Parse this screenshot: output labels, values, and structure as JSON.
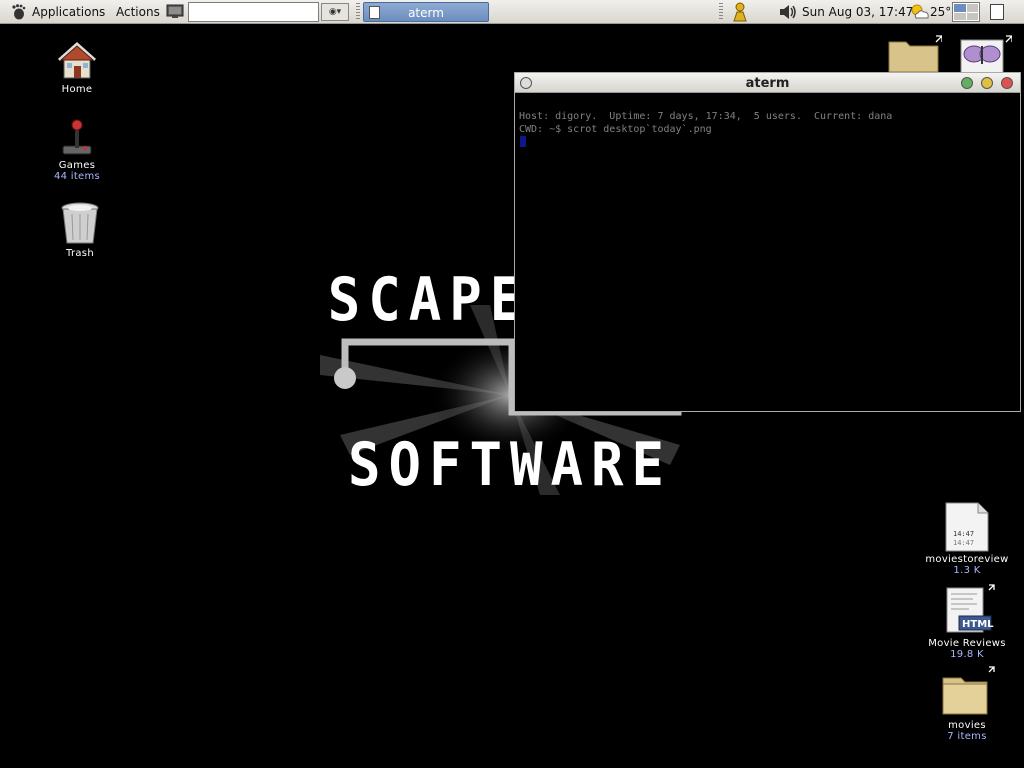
{
  "panel": {
    "menu_applications": "Applications",
    "menu_actions": "Actions",
    "command_value": "",
    "task_button_label": "aterm",
    "clock": "Sun Aug 03, 17:47",
    "temperature": "25°",
    "icons": {
      "foot": "gnome-foot-icon",
      "monitor": "run-command-icon",
      "person": "user-icon",
      "volume": "volume-icon",
      "weather": "partly-cloudy-icon",
      "show_desktop": "show-desktop-icon"
    }
  },
  "desktop": {
    "left_icons": [
      {
        "name": "Home",
        "sub": "",
        "icon": "home-icon"
      },
      {
        "name": "Games",
        "sub": "44 items",
        "icon": "joystick-icon"
      },
      {
        "name": "Trash",
        "sub": "",
        "icon": "trash-icon"
      }
    ],
    "right_icons": [
      {
        "name": "moviestoreview",
        "sub": "1.3 K",
        "icon": "text-file-icon",
        "preview": "14:47\n14:47"
      },
      {
        "name": "Movie Reviews",
        "sub": "19.8 K",
        "icon": "html-file-icon",
        "badge": "HTML"
      },
      {
        "name": "movies",
        "sub": "7 items",
        "icon": "folder-icon"
      }
    ],
    "top_right_icons": [
      {
        "icon": "folder-link-icon"
      },
      {
        "icon": "butterfly-image-icon"
      }
    ]
  },
  "wallpaper": {
    "line1": "SCAPEGOAT",
    "line2": "SOFTWARE"
  },
  "terminal": {
    "title": "aterm",
    "line1": "Host: digory.  Uptime: 7 days, 17:34,  5 users.  Current: dana",
    "line2": "CWD: ~$ scrot desktop`today`.png"
  },
  "colors": {
    "panel_bg": "#e4e2dc",
    "task_button": "#7a9ac8",
    "desktop_bg": "#000000",
    "icon_subtext": "#a9b7ff",
    "cursor": "#1a2bff",
    "close_button": "#e05050",
    "minimize_button": "#e0c040",
    "maximize_button": "#60b060"
  }
}
